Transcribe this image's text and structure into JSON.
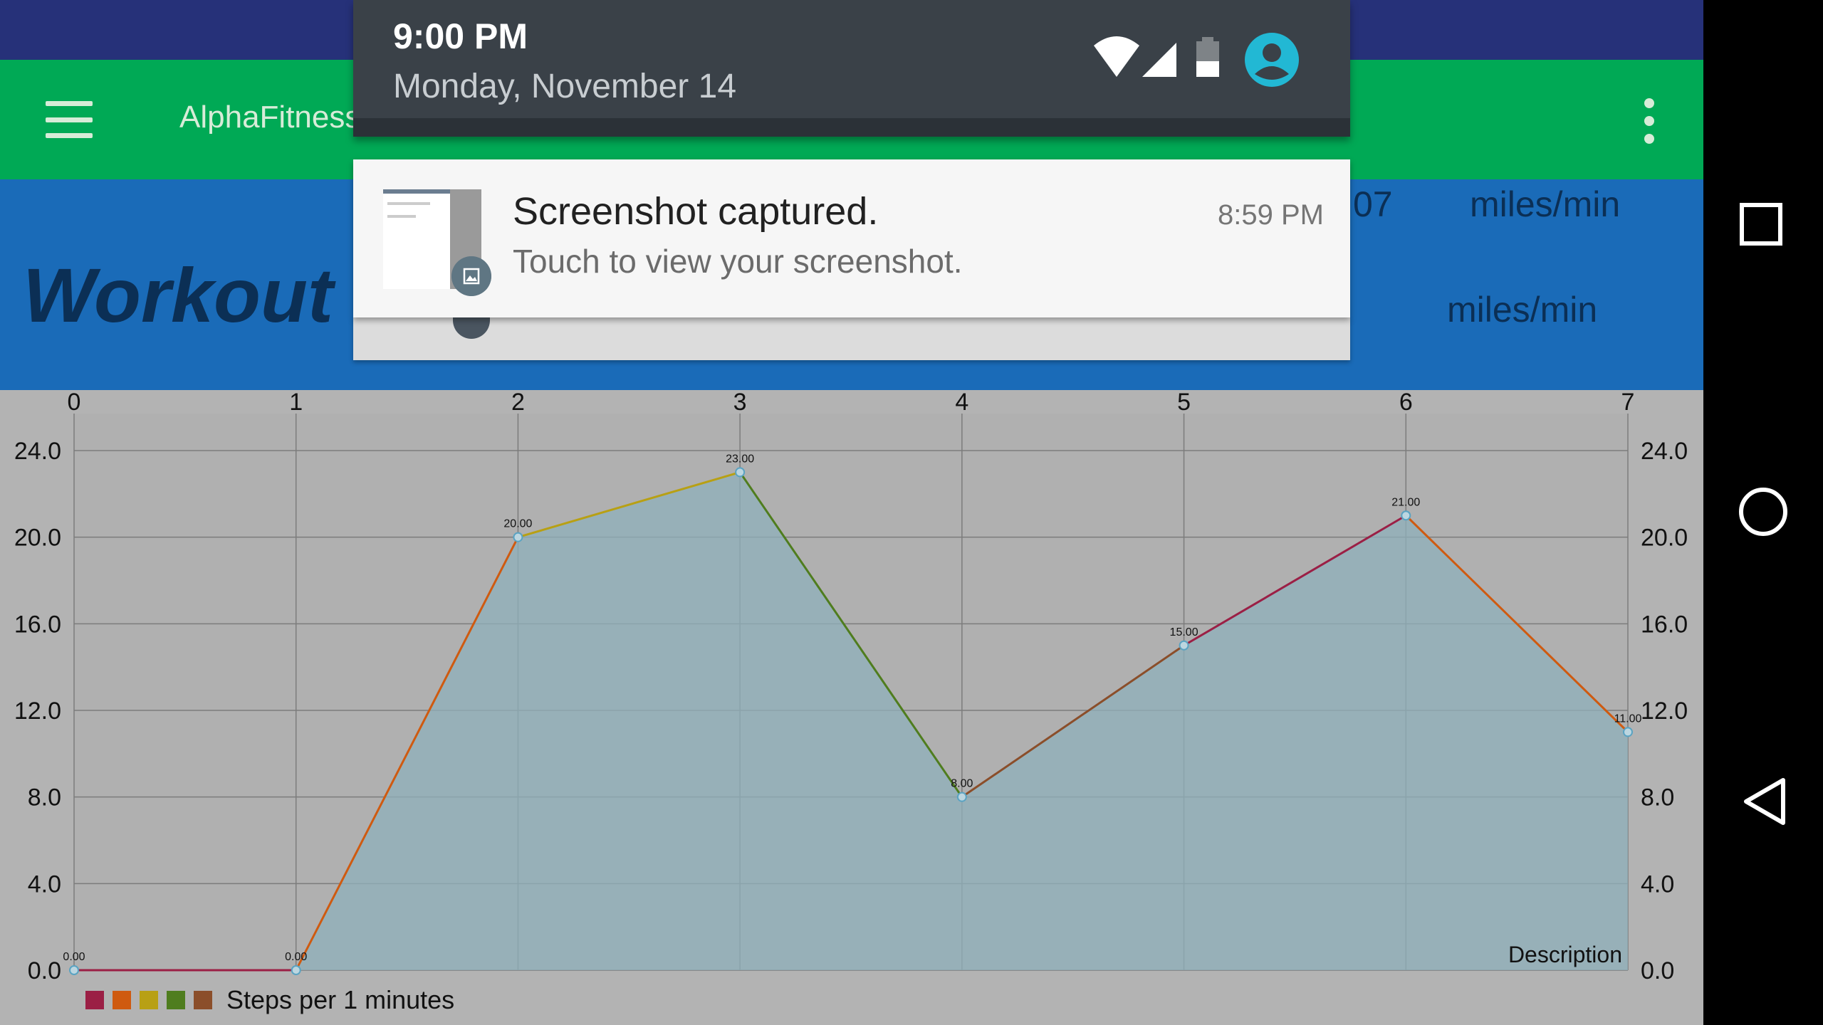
{
  "app": {
    "title": "AlphaFitness",
    "workout_title": "Workout Details",
    "stat_value": "07",
    "stat_unit_1": "miles/min",
    "stat_unit_2": "miles/min"
  },
  "notification_shade": {
    "time": "9:00 PM",
    "date": "Monday, November 14",
    "notification": {
      "title": "Screenshot captured.",
      "body": "Touch to view your screenshot.",
      "time": "8:59 PM"
    }
  },
  "colors": {
    "status_strip": "#263179",
    "toolbar": "#00a955",
    "header_band": "#1a6bb8",
    "chart_bg": "#b3b3b3",
    "fill": "#8fb0bb"
  },
  "icons": [
    "hamburger-icon",
    "overflow-menu-icon",
    "wifi-icon",
    "signal-icon",
    "battery-icon",
    "account-icon",
    "image-icon",
    "recents-icon",
    "home-icon",
    "back-icon"
  ],
  "chart_data": {
    "type": "area",
    "x": [
      0,
      1,
      2,
      3,
      4,
      5,
      6,
      7
    ],
    "x_tick_labels": [
      "0",
      "1",
      "2",
      "3",
      "4",
      "5",
      "6",
      "7"
    ],
    "values": [
      0,
      0,
      20,
      23,
      8,
      15,
      21,
      11
    ],
    "data_labels": [
      "0.00",
      "0.00",
      "20.00",
      "23.00",
      "8.00",
      "15.00",
      "21.00",
      "11.00"
    ],
    "y_tick_labels": [
      "0.0",
      "4.0",
      "8.0",
      "12.0",
      "16.0",
      "20.0",
      "24.0"
    ],
    "ylim": [
      0,
      24
    ],
    "xlim": [
      0,
      7
    ],
    "segment_colors": [
      "#9b1f45",
      "#cf5a10",
      "#b8a014",
      "#4f7d1e",
      "#8b4e2a",
      "#9b1f45",
      "#cf5a10"
    ],
    "description": "Description",
    "legend": {
      "label": "Steps per 1 minutes",
      "colors": [
        "#9b1f45",
        "#cf5a10",
        "#b8a014",
        "#4f7d1e",
        "#8b4e2a"
      ]
    },
    "grid": true,
    "legend_position": "bottom-left"
  }
}
